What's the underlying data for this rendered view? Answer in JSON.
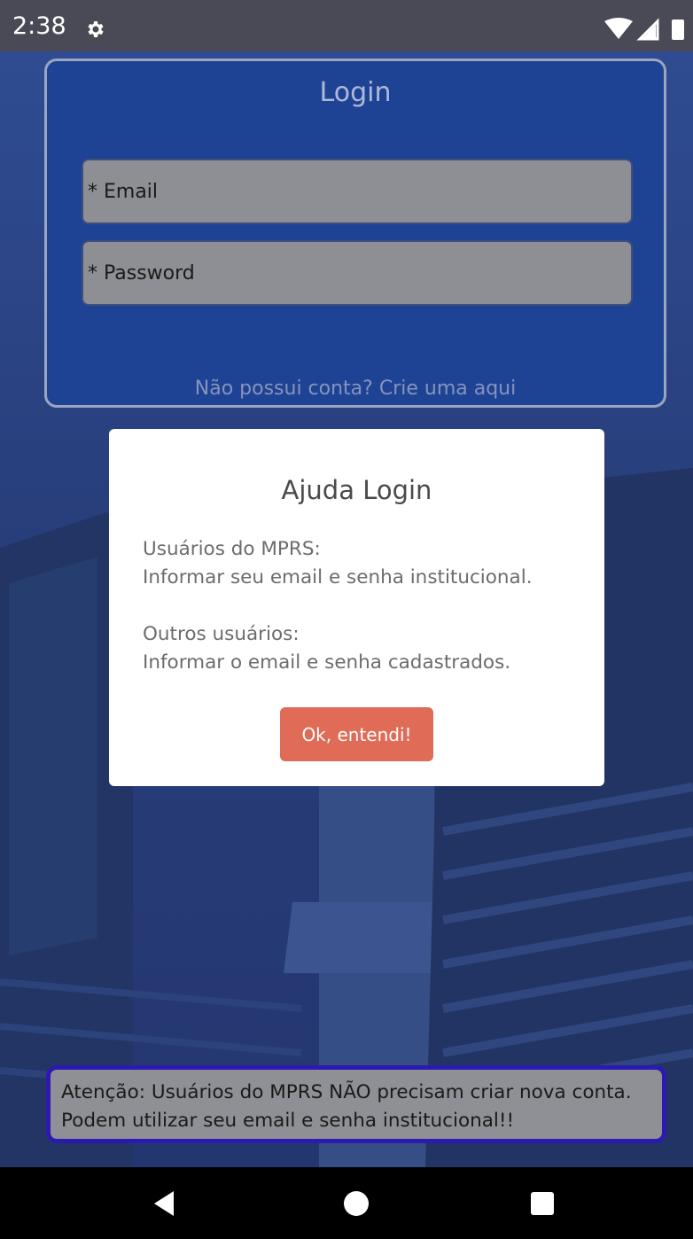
{
  "status_bar": {
    "time": "2:38",
    "icons": [
      "settings-icon",
      "wifi-icon",
      "cell-signal-icon",
      "battery-icon"
    ]
  },
  "login": {
    "title": "Login",
    "email_placeholder": "* Email",
    "password_placeholder": "* Password",
    "email_value": "",
    "password_value": "",
    "signup_link": "Não possui conta? Crie uma aqui"
  },
  "modal": {
    "title": "Ajuda Login",
    "text_1_line_1": "Usuários do MPRS:",
    "text_1_line_2": "Informar seu email e senha institucional.",
    "text_2_line_1": "Outros usuários:",
    "text_2_line_2": "Informar o email e senha cadastrados.",
    "button_label": "Ok, entendi!"
  },
  "warning": {
    "text": "Atenção: Usuários do MPRS NÃO precisam criar nova conta. Podem utilizar seu email e senha institucional!!"
  },
  "nav_bar": {
    "buttons": [
      "back-icon",
      "home-icon",
      "recents-icon"
    ]
  },
  "colors": {
    "card_background": "#1f4394",
    "button_accent": "#e06c57",
    "warning_border": "#2c1ab0",
    "input_background": "#8e8f94"
  }
}
